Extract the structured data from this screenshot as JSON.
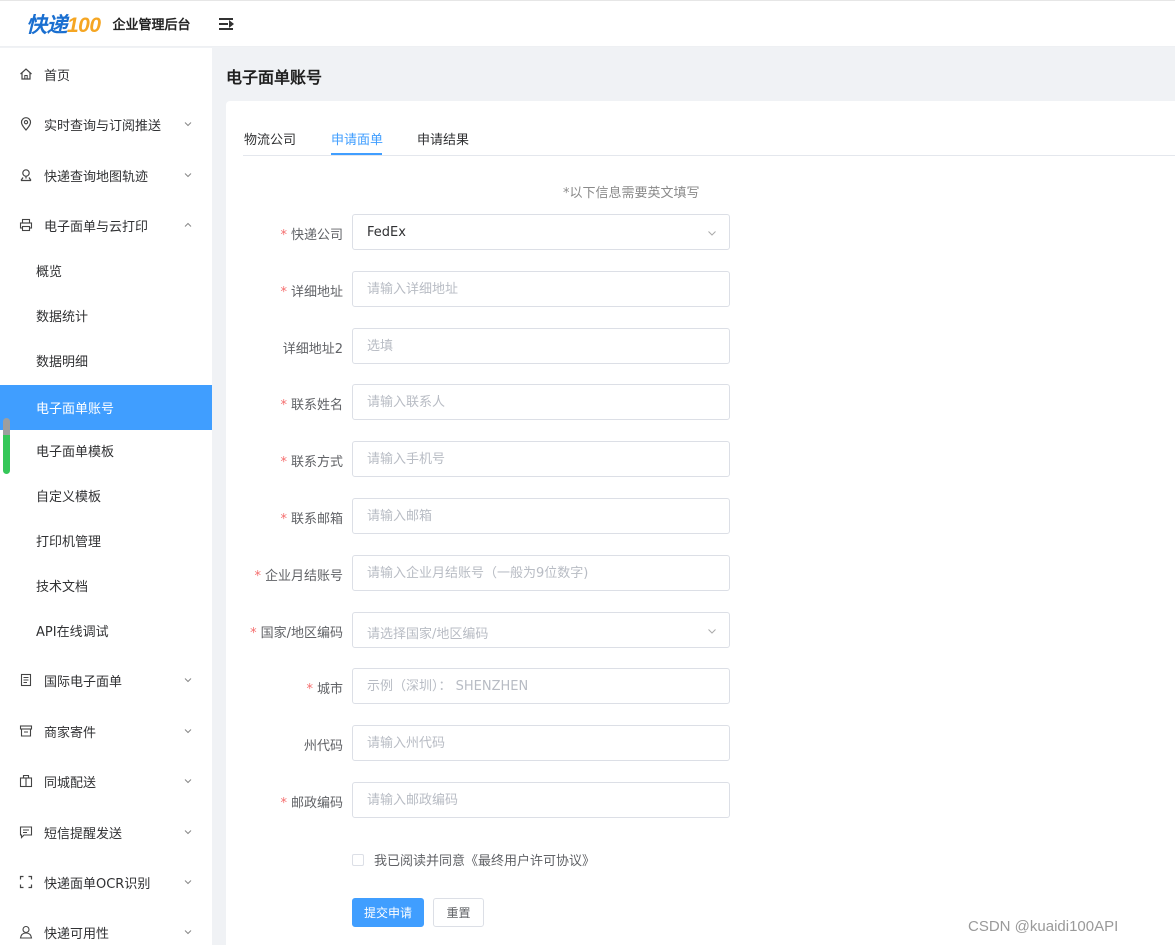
{
  "header": {
    "logo_part1": "快递",
    "logo_part2": "100",
    "app_title": "企业管理后台"
  },
  "sidebar": {
    "items": [
      {
        "label": "首页",
        "icon": "home-icon"
      },
      {
        "label": "实时查询与订阅推送",
        "icon": "location-pin-icon"
      },
      {
        "label": "快递查询地图轨迹",
        "icon": "map-pin-icon"
      },
      {
        "label": "电子面单与云打印",
        "icon": "printer-icon"
      },
      {
        "label": "国际电子面单",
        "icon": "document-icon"
      },
      {
        "label": "商家寄件",
        "icon": "store-icon"
      },
      {
        "label": "同城配送",
        "icon": "package-icon"
      },
      {
        "label": "短信提醒发送",
        "icon": "message-icon"
      },
      {
        "label": "快递面单OCR识别",
        "icon": "scan-icon"
      },
      {
        "label": "快递可用性",
        "icon": "user-icon"
      }
    ],
    "sub_items": [
      "概览",
      "数据统计",
      "数据明细",
      "电子面单账号",
      "电子面单模板",
      "自定义模板",
      "打印机管理",
      "技术文档",
      "API在线调试"
    ],
    "active_sub": "电子面单账号"
  },
  "page": {
    "title": "电子面单账号",
    "tabs": [
      "物流公司",
      "申请面单",
      "申请结果"
    ],
    "active_tab": "申请面单",
    "note": "*以下信息需要英文填写"
  },
  "form": {
    "courier": {
      "label": "快递公司",
      "value": "FedEx"
    },
    "address": {
      "label": "详细地址",
      "placeholder": "请输入详细地址"
    },
    "address2": {
      "label": "详细地址2",
      "placeholder": "选填"
    },
    "contact_name": {
      "label": "联系姓名",
      "placeholder": "请输入联系人"
    },
    "contact_phone": {
      "label": "联系方式",
      "placeholder": "请输入手机号"
    },
    "contact_email": {
      "label": "联系邮箱",
      "placeholder": "请输入邮箱"
    },
    "account": {
      "label": "企业月结账号",
      "placeholder": "请输入企业月结账号（一般为9位数字)"
    },
    "country": {
      "label": "国家/地区编码",
      "placeholder": "请选择国家/地区编码"
    },
    "city": {
      "label": "城市",
      "placeholder": "示例（深圳）： SHENZHEN"
    },
    "state": {
      "label": "州代码",
      "placeholder": "请输入州代码"
    },
    "postal": {
      "label": "邮政编码",
      "placeholder": "请输入邮政编码"
    },
    "agree_text": "我已阅读并同意《最终用户许可协议》",
    "submit_label": "提交申请",
    "reset_label": "重置"
  },
  "watermark": "CSDN @kuaidi100API",
  "colors": {
    "accent": "#409eff",
    "required": "#f56c6c"
  }
}
